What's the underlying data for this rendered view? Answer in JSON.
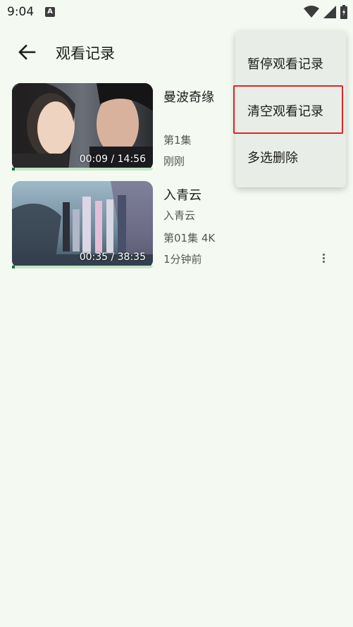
{
  "status_bar": {
    "time": "9:04",
    "notification_icon": "A"
  },
  "appbar": {
    "title": "观看记录"
  },
  "history": [
    {
      "title": "曼波奇缘",
      "subtitle": "",
      "episode": "第1集",
      "time_ago": "刚刚",
      "duration": "00:09 / 14:56",
      "progress_fraction": 0.01
    },
    {
      "title": "入青云",
      "subtitle": "入青云",
      "episode": "第01集 4K",
      "time_ago": "1分钟前",
      "duration": "00:35 / 38:35",
      "progress_fraction": 0.015
    }
  ],
  "menu": {
    "items": [
      "暂停观看记录",
      "清空观看记录",
      "多选删除"
    ],
    "highlighted_index": 1
  },
  "colors": {
    "background": "#f4faf2",
    "progress_track": "#c7e4c9",
    "progress_fill": "#1e6b3a",
    "highlight_border": "#e02424"
  }
}
